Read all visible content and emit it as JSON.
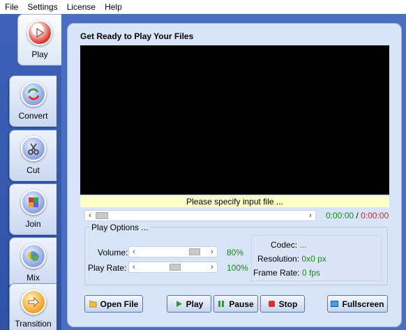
{
  "menu": [
    "File",
    "Settings",
    "License",
    "Help"
  ],
  "tabs": [
    {
      "name": "play",
      "label": "Play",
      "icon": "play-icon",
      "color": "#d8342c",
      "active": true
    },
    {
      "name": "convert",
      "label": "Convert",
      "icon": "convert-icon",
      "color": "#3aa04a"
    },
    {
      "name": "cut",
      "label": "Cut",
      "icon": "scissors-icon",
      "color": "#8a8ac8"
    },
    {
      "name": "join",
      "label": "Join",
      "icon": "puzzle-icon",
      "color": "#6a5cc8"
    },
    {
      "name": "mix",
      "label": "Mix",
      "icon": "mix-icon",
      "color": "#4a8ae0"
    },
    {
      "name": "transition",
      "label": "Transition",
      "icon": "arrow-right-icon",
      "color": "#f0a020"
    }
  ],
  "panel": {
    "title": "Get Ready to Play Your Files",
    "status": "Please specify input file ...",
    "time_current": "0:00:00",
    "time_separator": "/",
    "time_total": "0:00:00",
    "options": {
      "title": "Play Options ...",
      "volume_label": "Volume:",
      "volume_value": "80%",
      "rate_label": "Play Rate:",
      "rate_value": "100%"
    },
    "info": {
      "codec_label": "Codec:",
      "codec_value": "...",
      "resolution_label": "Resolution:",
      "resolution_value": "0x0 px",
      "framerate_label": "Frame Rate:",
      "framerate_value": "0 fps"
    },
    "buttons": {
      "open": "Open File",
      "play": "Play",
      "pause": "Pause",
      "stop": "Stop",
      "fullscreen": "Fullscreen"
    }
  },
  "colors": {
    "accent_blue": "#2f52a6",
    "time_green": "#1a8a1a",
    "time_red": "#b03030"
  }
}
